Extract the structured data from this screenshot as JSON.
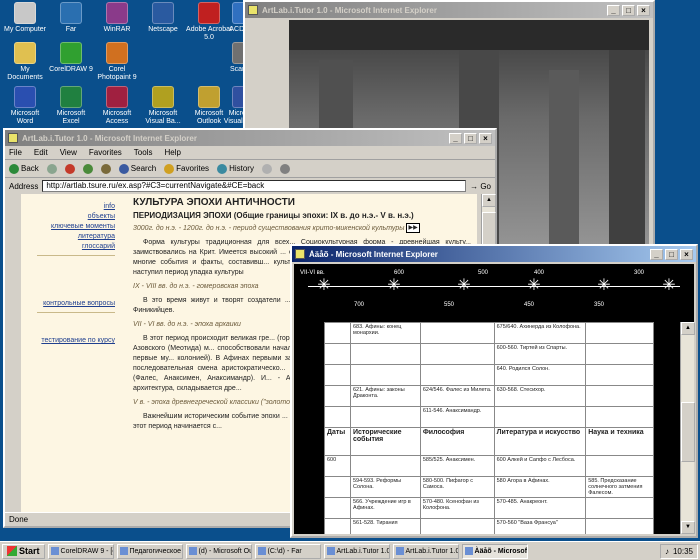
{
  "desktop_icons": [
    {
      "label": "My Computer",
      "color": "#c8c8c8"
    },
    {
      "label": "Far",
      "color": "#2a6fb0"
    },
    {
      "label": "WinRAR",
      "color": "#8a3a8a"
    },
    {
      "label": "Netscape",
      "color": "#2a5aa0"
    },
    {
      "label": "Adobe Acrobat 5.0",
      "color": "#c02020"
    },
    {
      "label": "ACDSee",
      "color": "#3070c0"
    },
    {
      "label": "My Documents",
      "color": "#e0c050"
    },
    {
      "label": "CorelDRAW 9",
      "color": "#30a030"
    },
    {
      "label": "Corel Photopaint 9",
      "color": "#d07020"
    },
    {
      "label": "Scanner",
      "color": "#707070"
    },
    {
      "label": "Microsoft Word",
      "color": "#2a4fb0"
    },
    {
      "label": "Microsoft Excel",
      "color": "#208040"
    },
    {
      "label": "Microsoft Access",
      "color": "#a02040"
    },
    {
      "label": "Microsoft Visual Ba...",
      "color": "#b0a020"
    },
    {
      "label": "Microsoft Outlook",
      "color": "#c0a030"
    },
    {
      "label": "Microsoft Visual Inte...",
      "color": "#3050a0"
    }
  ],
  "win_back": {
    "title": "ArtLab.i.Tutor 1.0 - Microsoft Internet Explorer"
  },
  "win_mid": {
    "title": "ArtLab.i.Tutor 1.0 - Microsoft Internet Explorer",
    "menu": [
      "File",
      "Edit",
      "View",
      "Favorites",
      "Tools",
      "Help"
    ],
    "toolbar": {
      "back": "Back",
      "search": "Search",
      "favorites": "Favorites",
      "history": "History"
    },
    "address_label": "Address",
    "address_value": "http://artlab.tsure.ru/ex.asp?#C3=currentNavigate&#CE=back",
    "go_label": "Go",
    "status": "Done",
    "nav": {
      "group1": [
        "info",
        "объекты",
        "ключевые моменты",
        "литература",
        "глоссарий"
      ],
      "group2": [
        "контрольные вопросы"
      ],
      "group3": [
        "тестирование по курсу"
      ]
    },
    "content": {
      "heading": "КУЛЬТУРА ЭПОХИ АНТИЧНОСТИ",
      "subheading": "ПЕРИОДИЗАЦИЯ ЭПОХИ (Общие границы эпохи: IX в. до н.э.- V в. н.э.)",
      "era1": "3000г. до н.э. - 1200г. до н.э. - период существования крито-микенской культуры",
      "para1": "Форма культуры традиционная для всех... Социокультурная форма - древнейшая культу... заимствовались на Крит. Имеется высокий ... связи по всему Средиземноморью и на Во... войны и многие события и факты, составивш... культурной эпохи было прервано нашеств... После чего наступил период упадка культуры",
      "era2": "IX - VIII вв. до н.э. - гомеровская эпоха",
      "para2": "В это время живут и творят создатели ... уникальная социокультурная форма - полис, ... от Финикийцев.",
      "era3": "VII - VI вв. до н.э. - эпоха архаики",
      "para3": "В этот период происходит великая гре... (города-полисы) в различных районах Сре... Эвксинский) и Азовского (Меотида) м... способствовали начало социально-политиче... система полиса. Появляются первые му... колонией). В Афинах первыми законодател... Спарте - Ликург. В процессе социальн... последовательная смена аристократическо... Появляются первые философы и философ... школа (Фалес, Анаксимен, Анаксимандр). И... - Архилах, Анакреонт, Сафо. Появляет... развиваться архитектура, складывается дре...",
      "era4": "V в. - эпоха древнегреческой классики (\"золотой век\" Афин)",
      "para4": "Важнейшим историческим событие эпохи ... является то, что в греческом войске все б... полисов. В этот период начинается с..."
    }
  },
  "win_front": {
    "title": "Àäåõ - Microsoft Internet Explorer",
    "timeline": {
      "top": [
        "VII-VI вв.",
        "600",
        "500",
        "400",
        "300"
      ],
      "bottom": [
        "700",
        "550",
        "450",
        "350"
      ]
    },
    "table": {
      "headers": [
        "Даты",
        "Исторические события",
        "Философия",
        "Литература и искусство",
        "Наука и техника"
      ],
      "rows": [
        [
          "",
          "683. Афины: конец монархии.",
          "",
          "675/640. Ахинерда из Колофона.",
          ""
        ],
        [
          "",
          "",
          "",
          "600-560. Тиртей из Спарты.",
          ""
        ],
        [
          "",
          "",
          "",
          "640. Родился Солон.",
          ""
        ],
        [
          "",
          "621. Афины: законы Драконта.",
          "624/546. Фалес из Милета.",
          "630-568. Стесихор.",
          ""
        ],
        [
          "",
          "",
          "611-546. Анаксимандр.",
          "",
          ""
        ],
        [
          "600",
          "",
          "585/525. Анаксимен.",
          "600 Алкей и Сапфо с Лесбоса.",
          ""
        ],
        [
          "",
          "594-593. Реформы Солона.",
          "580-500. Пифагор с Самоса.",
          "580 Агора в Афинах.",
          "585. Предсказание солнечного затмения Фалесом."
        ],
        [
          "",
          "566. Учреждение игр в Афинах.",
          "570-480. Ксенофан из Колофона.",
          "570-485. Анакреонт.",
          ""
        ],
        [
          "",
          "561-528. Тирания",
          "",
          "570-560 \"Ваза Франсуа\"",
          ""
        ]
      ]
    }
  },
  "taskbar": {
    "start": "Start",
    "tasks": [
      "CorelDRAW 9 - [c...",
      "Педагогическое ...",
      "(d) - Microsoft Ou...",
      "(C:\\d) - Far",
      "ArtLab.i.Tutor 1.0...",
      "ArtLab.i.Tutor 1.0...",
      "Àäåõ - Microsoft..."
    ],
    "active_task": 6,
    "clock": "10:35"
  }
}
